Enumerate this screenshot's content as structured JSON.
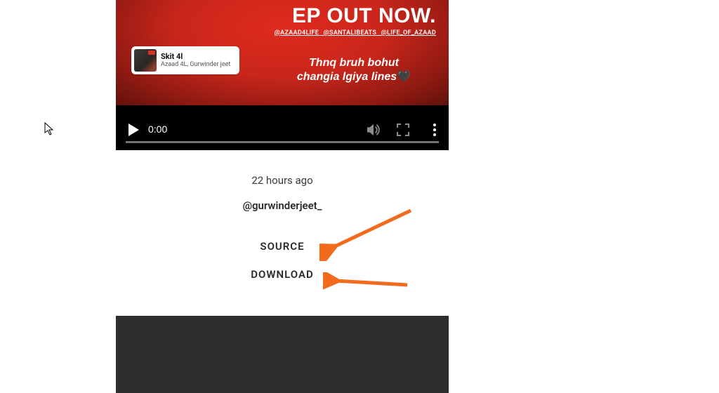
{
  "video": {
    "ep_title": "EP OUT NOW.",
    "handles": "@AZAAD4LIFE @SANTALIBEATS @LIFE_OF_AZAAD",
    "quote_line1": "Thnq bruh bohut",
    "quote_line2": "changia lgiya lines",
    "heart": "🖤",
    "track": {
      "title": "Skit 4l",
      "artist": "Azaad 4L, Gurwinder jeet"
    },
    "controls": {
      "timecode": "0:00"
    }
  },
  "meta": {
    "when": "22 hours ago",
    "handle": "@gurwinderjeet_",
    "source_label": "SOURCE",
    "download_label": "DOWNLOAD"
  },
  "colors": {
    "annotation": "#f26a1b"
  }
}
